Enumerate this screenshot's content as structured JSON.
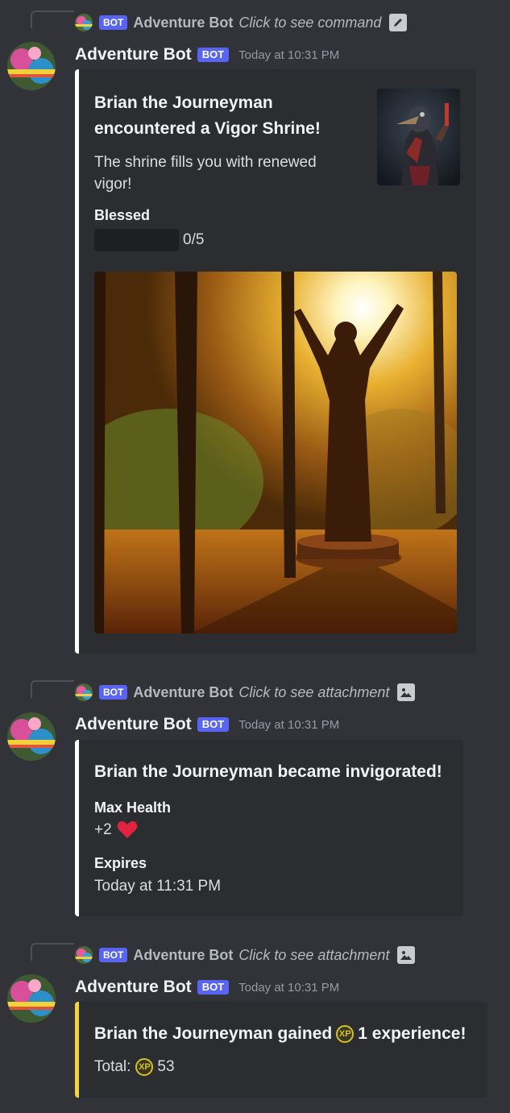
{
  "messages": [
    {
      "reply": {
        "badge": "BOT",
        "name": "Adventure Bot",
        "action": "Click to see command",
        "icon": "pencil-icon"
      },
      "author": "Adventure Bot",
      "badge": "BOT",
      "timestamp": "Today at 10:31 PM",
      "embed": {
        "title_line1": "Brian the Journeyman",
        "title_line2": "encountered a Vigor Shrine!",
        "description_line1": "The shrine fills you with renewed",
        "description_line2": "vigor!",
        "field_name": "Blessed",
        "progress_text": "0/5",
        "progress_value": 0,
        "progress_max": 5,
        "thumbnail": "plague-doctor-character-thumbnail",
        "image": "golden-forest-shrine-statue-image"
      }
    },
    {
      "reply": {
        "badge": "BOT",
        "name": "Adventure Bot",
        "action": "Click to see attachment",
        "icon": "image-icon"
      },
      "author": "Adventure Bot",
      "badge": "BOT",
      "timestamp": "Today at 10:31 PM",
      "embed": {
        "title": "Brian the Journeyman became invigorated!",
        "field1_name": "Max Health",
        "field1_value": "+2",
        "field2_name": "Expires",
        "field2_value": "Today at 11:31 PM"
      }
    },
    {
      "reply": {
        "badge": "BOT",
        "name": "Adventure Bot",
        "action": "Click to see attachment",
        "icon": "image-icon"
      },
      "author": "Adventure Bot",
      "badge": "BOT",
      "timestamp": "Today at 10:31 PM",
      "embed": {
        "title_prefix": "Brian the Journeyman gained",
        "title_suffix": "1 experience!",
        "xp_label": "XP",
        "total_label": "Total:",
        "total_value": "53",
        "accent": "#f0d541"
      }
    }
  ],
  "colors": {
    "background": "#313338",
    "embed_bg": "#2b2d31",
    "bot_badge": "#5865f2",
    "heart": "#e0243f",
    "xp": "#d6c21c"
  }
}
